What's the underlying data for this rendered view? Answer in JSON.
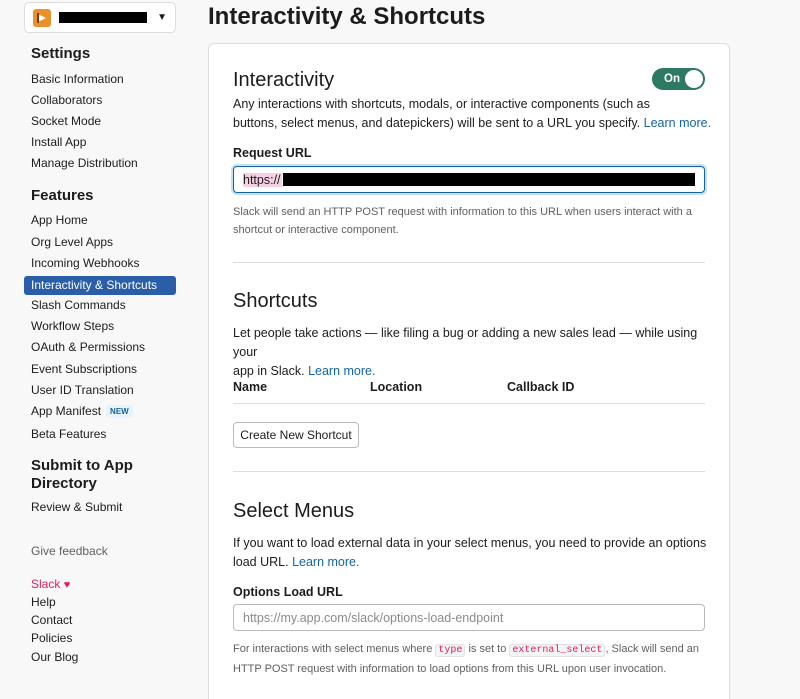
{
  "app": {
    "name_redacted": true
  },
  "sidebar": {
    "settings_heading": "Settings",
    "settings_items": [
      {
        "label": "Basic Information"
      },
      {
        "label": "Collaborators"
      },
      {
        "label": "Socket Mode"
      },
      {
        "label": "Install App"
      },
      {
        "label": "Manage Distribution"
      }
    ],
    "features_heading": "Features",
    "features_items": [
      {
        "label": "App Home"
      },
      {
        "label": "Org Level Apps"
      },
      {
        "label": "Incoming Webhooks"
      },
      {
        "label": "Interactivity & Shortcuts",
        "active": true
      },
      {
        "label": "Slash Commands"
      },
      {
        "label": "Workflow Steps"
      },
      {
        "label": "OAuth & Permissions"
      },
      {
        "label": "Event Subscriptions"
      },
      {
        "label": "User ID Translation"
      },
      {
        "label": "App Manifest",
        "badge": "NEW"
      },
      {
        "label": "Beta Features"
      }
    ],
    "submit_heading_line1": "Submit to App",
    "submit_heading_line2": "Directory",
    "review_submit": "Review & Submit",
    "give_feedback": "Give feedback",
    "footer": {
      "slack": "Slack",
      "heart": "♥",
      "help": "Help",
      "contact": "Contact",
      "policies": "Policies",
      "blog": "Our Blog"
    }
  },
  "page_title": "Interactivity & Shortcuts",
  "interactivity": {
    "title": "Interactivity",
    "toggle_label": "On",
    "toggle_on": true,
    "desc_line1": "Any interactions with shortcuts, modals, or interactive components (such as",
    "desc_line2": "buttons, select menus, and datepickers) will be sent to a URL you specify.",
    "learn_more": "Learn more.",
    "request_url_label": "Request URL",
    "request_url_value": "https://",
    "help_line1": "Slack will send an HTTP POST request with information to this URL when users interact with a",
    "help_line2": "shortcut or interactive component."
  },
  "shortcuts": {
    "title": "Shortcuts",
    "desc_line1": "Let people take actions — like filing a bug or adding a new sales lead — while using your",
    "desc_line2": "app in Slack.",
    "learn_more": "Learn more.",
    "columns": [
      "Name",
      "Location",
      "Callback ID"
    ],
    "create_button": "Create New Shortcut"
  },
  "select_menus": {
    "title": "Select Menus",
    "desc_line1": "If you want to load external data in your select menus, you need to provide an options",
    "desc_line2": "load URL.",
    "learn_more": "Learn more.",
    "options_label": "Options Load URL",
    "options_placeholder": "https://my.app.com/slack/options-load-endpoint",
    "help_part1": "For interactions with select menus where",
    "code1": "type",
    "help_part2": "is set to",
    "code2": "external_select",
    "help_part3": ", Slack will send an",
    "help_line2": "HTTP POST request with information to load options from this URL upon user invocation."
  },
  "colors": {
    "active_nav": "#2a5ea8",
    "toggle_on": "#2b7a61",
    "link": "#1264a3"
  }
}
